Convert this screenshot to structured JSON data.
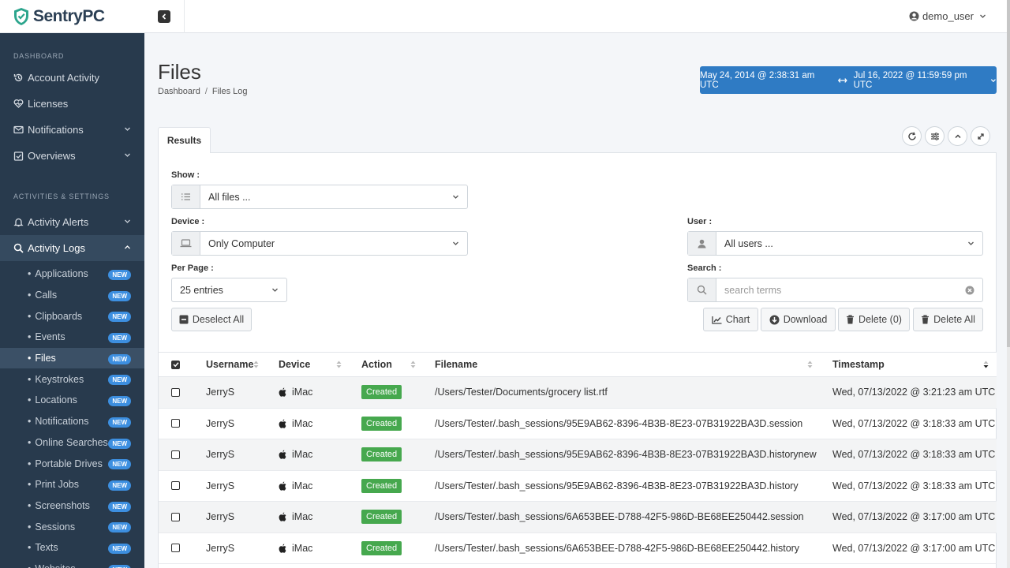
{
  "brand": {
    "name": "SentryPC"
  },
  "topbar": {
    "user": "demo_user"
  },
  "sidebar": {
    "section1": "DASHBOARD",
    "section2": "ACTIVITIES & SETTINGS",
    "items": [
      {
        "label": "Account Activity",
        "icon": "history-icon"
      },
      {
        "label": "Licenses",
        "icon": "heart-pulse-icon"
      },
      {
        "label": "Notifications",
        "icon": "envelope-icon"
      },
      {
        "label": "Overviews",
        "icon": "check-square-icon"
      },
      {
        "label": "Activity Alerts",
        "icon": "bell-icon"
      },
      {
        "label": "Activity Logs",
        "icon": "search-icon"
      }
    ],
    "sub_items": [
      "Applications",
      "Calls",
      "Clipboards",
      "Events",
      "Files",
      "Keystrokes",
      "Locations",
      "Notifications",
      "Online Searches",
      "Portable Drives",
      "Print Jobs",
      "Screenshots",
      "Sessions",
      "Texts",
      "Websites"
    ],
    "badge": "NEW"
  },
  "page": {
    "title": "Files",
    "breadcrumb": [
      "Dashboard",
      "Files Log"
    ],
    "date_from": "May 24, 2014 @ 2:38:31 am UTC",
    "date_to": "Jul 16, 2022 @ 11:59:59 pm UTC"
  },
  "panel": {
    "tab": "Results",
    "show_label": "Show :",
    "show_value": "All files ...",
    "device_label": "Device :",
    "device_value": "Only Computer",
    "user_label": "User :",
    "user_value": "All users ...",
    "perpage_label": "Per Page :",
    "perpage_value": "25 entries",
    "search_label": "Search :",
    "search_placeholder": "search terms",
    "deselect": "Deselect All",
    "chart": "Chart",
    "download": "Download",
    "delete": "Delete (0)",
    "delete_all": "Delete All"
  },
  "table": {
    "headers": {
      "username": "Username",
      "device": "Device",
      "action": "Action",
      "filename": "Filename",
      "timestamp": "Timestamp"
    },
    "rows": [
      {
        "username": "JerryS",
        "device": "iMac",
        "action": "Created",
        "filename": "/Users/Tester/Documents/grocery list.rtf",
        "timestamp": "Wed, 07/13/2022 @ 3:21:23 am UTC"
      },
      {
        "username": "JerryS",
        "device": "iMac",
        "action": "Created",
        "filename": "/Users/Tester/.bash_sessions/95E9AB62-8396-4B3B-8E23-07B31922BA3D.session",
        "timestamp": "Wed, 07/13/2022 @ 3:18:33 am UTC"
      },
      {
        "username": "JerryS",
        "device": "iMac",
        "action": "Created",
        "filename": "/Users/Tester/.bash_sessions/95E9AB62-8396-4B3B-8E23-07B31922BA3D.historynew",
        "timestamp": "Wed, 07/13/2022 @ 3:18:33 am UTC"
      },
      {
        "username": "JerryS",
        "device": "iMac",
        "action": "Created",
        "filename": "/Users/Tester/.bash_sessions/95E9AB62-8396-4B3B-8E23-07B31922BA3D.history",
        "timestamp": "Wed, 07/13/2022 @ 3:18:33 am UTC"
      },
      {
        "username": "JerryS",
        "device": "iMac",
        "action": "Created",
        "filename": "/Users/Tester/.bash_sessions/6A653BEE-D788-42F5-986D-BE68EE250442.session",
        "timestamp": "Wed, 07/13/2022 @ 3:17:00 am UTC"
      },
      {
        "username": "JerryS",
        "device": "iMac",
        "action": "Created",
        "filename": "/Users/Tester/.bash_sessions/6A653BEE-D788-42F5-986D-BE68EE250442.history",
        "timestamp": "Wed, 07/13/2022 @ 3:17:00 am UTC"
      }
    ]
  },
  "colors": {
    "sidebar": "#283a4d",
    "accent": "#2f7bc4",
    "created": "#46a84e",
    "badge": "#3d8fe0"
  }
}
